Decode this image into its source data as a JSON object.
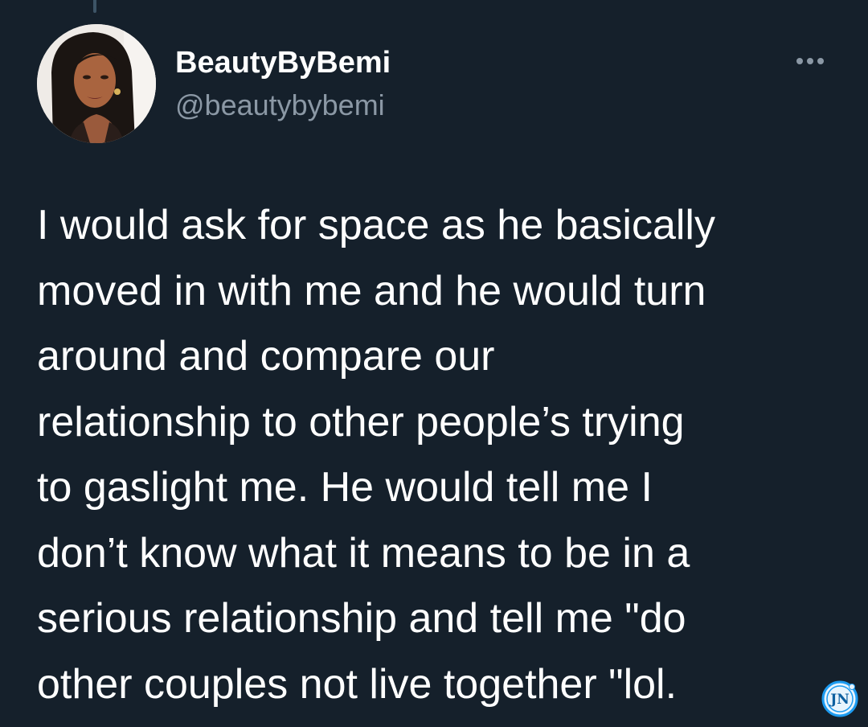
{
  "tweet": {
    "display_name": "BeautyByBemi",
    "handle": "@beautybybemi",
    "text": "I would ask for space as he basically\nmoved in with me and he would turn\naround and compare our\nrelationship to other people’s trying\nto gaslight me. He would tell me I\ndon’t know what it means to be in a\nserious relationship and tell me \"do\nother couples not live together \"lol.",
    "more_icon": "more-horizontal-icon"
  },
  "watermark": {
    "text": "JN"
  },
  "colors": {
    "background": "#15202b",
    "primary_text": "#ffffff",
    "secondary_text": "#8b98a5",
    "watermark": "#1d9bf0"
  }
}
